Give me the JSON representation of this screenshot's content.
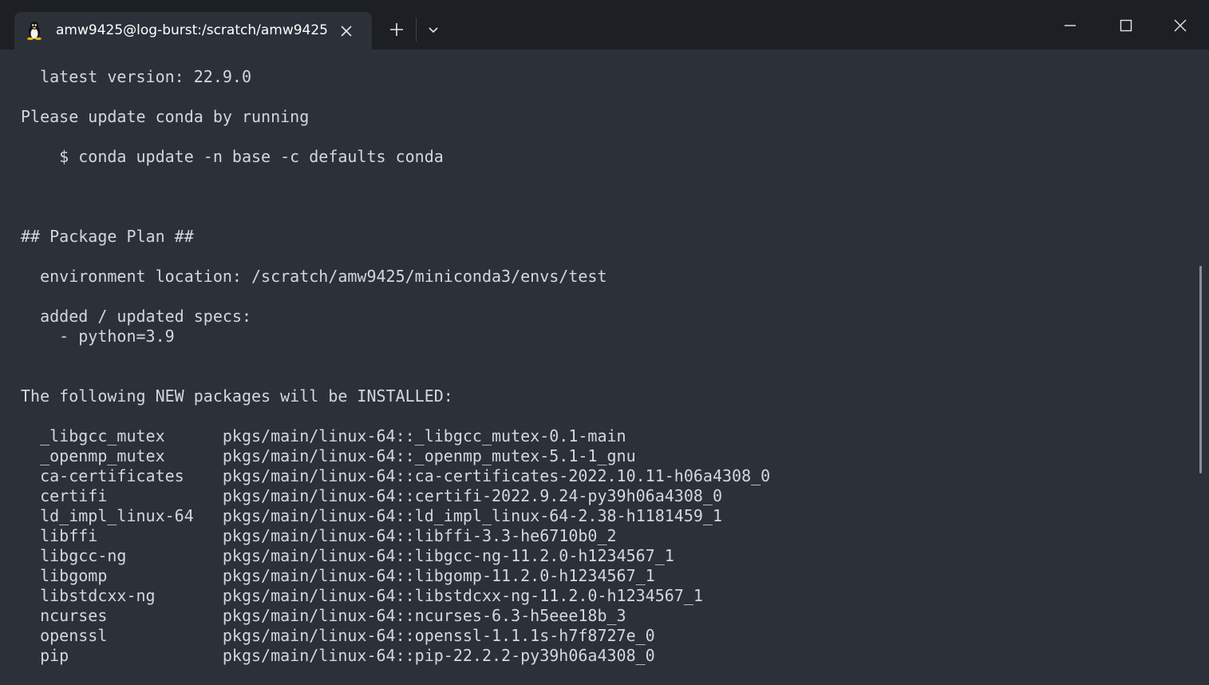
{
  "window": {
    "tab_title": "amw9425@log-burst:/scratch/amw9425",
    "tab_icon": "linux-penguin-icon",
    "new_tab_icon": "plus-icon",
    "dropdown_icon": "chevron-down-icon",
    "controls": [
      "minimize-icon",
      "maximize-icon",
      "close-icon"
    ]
  },
  "terminal": {
    "lines": [
      "  latest version: 22.9.0",
      "",
      "Please update conda by running",
      "",
      "    $ conda update -n base -c defaults conda",
      "",
      "",
      "",
      "## Package Plan ##",
      "",
      "  environment location: /scratch/amw9425/miniconda3/envs/test",
      "",
      "  added / updated specs:",
      "    - python=3.9",
      "",
      "",
      "The following NEW packages will be INSTALLED:",
      "",
      "  _libgcc_mutex      pkgs/main/linux-64::_libgcc_mutex-0.1-main",
      "  _openmp_mutex      pkgs/main/linux-64::_openmp_mutex-5.1-1_gnu",
      "  ca-certificates    pkgs/main/linux-64::ca-certificates-2022.10.11-h06a4308_0",
      "  certifi            pkgs/main/linux-64::certifi-2022.9.24-py39h06a4308_0",
      "  ld_impl_linux-64   pkgs/main/linux-64::ld_impl_linux-64-2.38-h1181459_1",
      "  libffi             pkgs/main/linux-64::libffi-3.3-he6710b0_2",
      "  libgcc-ng          pkgs/main/linux-64::libgcc-ng-11.2.0-h1234567_1",
      "  libgomp            pkgs/main/linux-64::libgomp-11.2.0-h1234567_1",
      "  libstdcxx-ng       pkgs/main/linux-64::libstdcxx-ng-11.2.0-h1234567_1",
      "  ncurses            pkgs/main/linux-64::ncurses-6.3-h5eee18b_3",
      "  openssl            pkgs/main/linux-64::openssl-1.1.1s-h7f8727e_0",
      "  pip                pkgs/main/linux-64::pip-22.2.2-py39h06a4308_0"
    ]
  },
  "colors": {
    "titlebar": "#1c1f24",
    "terminal_bg": "#2c3038",
    "text": "#d4d7dc"
  }
}
